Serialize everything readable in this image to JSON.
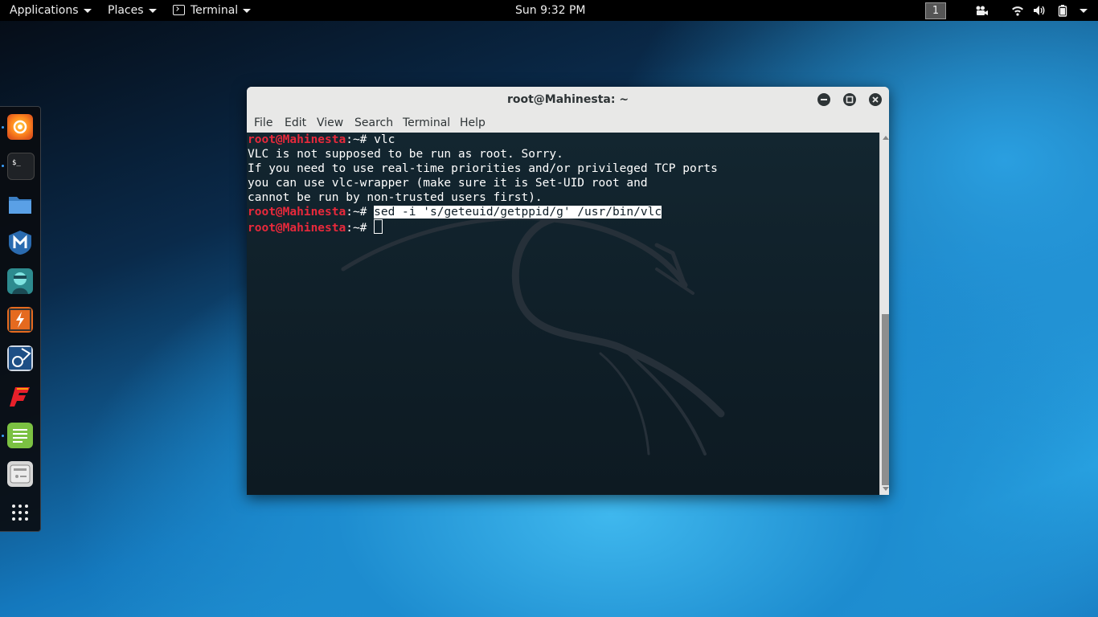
{
  "topbar": {
    "applications": "Applications",
    "places": "Places",
    "terminal": "Terminal",
    "clock": "Sun  9:32 PM",
    "workspace": "1"
  },
  "dock": {
    "items": [
      "firefox-icon",
      "terminal-icon",
      "files-icon",
      "metasploit-icon",
      "armitage-icon",
      "burpsuite-icon",
      "beef-icon",
      "faraday-icon",
      "leafpad-icon",
      "cherrytree-icon",
      "show-apps-icon"
    ]
  },
  "window": {
    "title": "root@Mahinesta: ~",
    "menu": [
      "File",
      "Edit",
      "View",
      "Search",
      "Terminal",
      "Help"
    ]
  },
  "terminal": {
    "prompt": "root@Mahinesta",
    "prompt_suffix": ":~# ",
    "cmd1": "vlc",
    "out1": "VLC is not supposed to be run as root. Sorry.",
    "out2": "If you need to use real-time priorities and/or privileged TCP ports",
    "out3": "you can use vlc-wrapper (make sure it is Set-UID root and",
    "out4": "cannot be run by non-trusted users first).",
    "cmd2": "sed -i 's/geteuid/getppid/g' /usr/bin/vlc"
  },
  "colors": {
    "prompt": "#e8293b",
    "terminal_bg": "#132630",
    "accent": "#3aa0ff"
  }
}
